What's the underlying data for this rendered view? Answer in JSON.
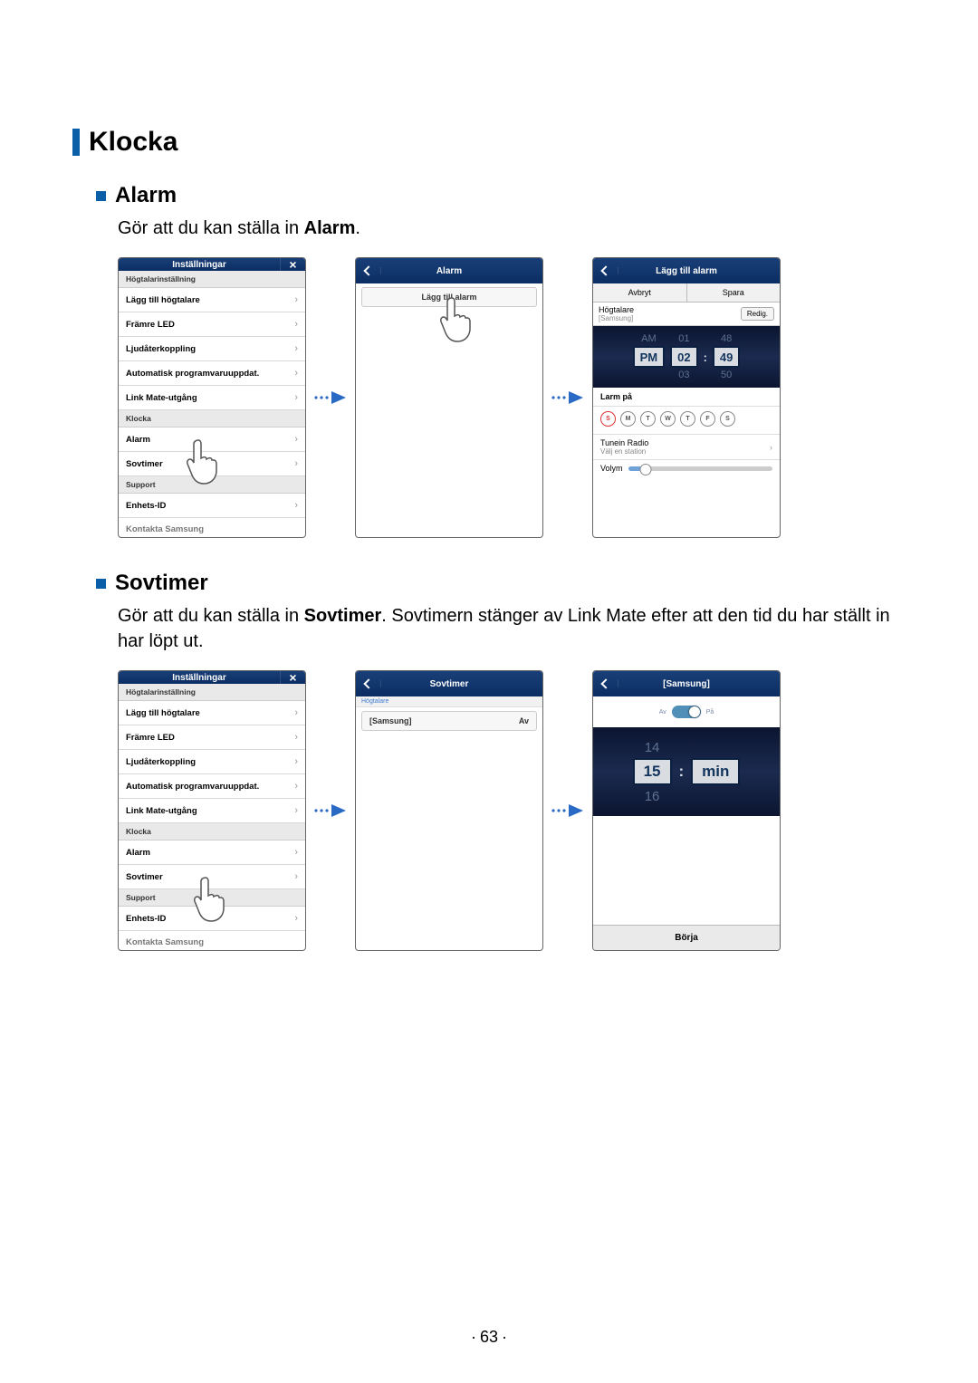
{
  "section": {
    "klocka": "Klocka",
    "alarm": "Alarm",
    "sovtimer": "Sovtimer"
  },
  "txt": {
    "alarm_pre": "Gör att du kan ställa in ",
    "alarm_bold": "Alarm",
    "alarm_post": ".",
    "sov_pre": "Gör att du kan ställa in ",
    "sov_bold": "Sovtimer",
    "sov_post": ". Sovtimern stänger av Link Mate efter att den tid du har ställt in har löpt ut."
  },
  "settings": {
    "title": "Inställningar",
    "sec_speaker": "Högtalarinställning",
    "items_speaker": [
      "Lägg till högtalare",
      "Främre LED",
      "Ljudåterkoppling",
      "Automatisk programvaruuppdat.",
      "Link Mate-utgång"
    ],
    "sec_klocka": "Klocka",
    "items_klocka": [
      "Alarm",
      "Sovtimer"
    ],
    "sec_support": "Support",
    "items_support": [
      "Enhets-ID"
    ],
    "cutoff": "Kontakta Samsung"
  },
  "alarm_screen": {
    "title": "Alarm",
    "add": "Lägg till alarm"
  },
  "add_alarm": {
    "title": "Lägg till alarm",
    "cancel": "Avbryt",
    "save": "Spara",
    "speaker_label": "Högtalare",
    "speaker_value": "[Samsung]",
    "edit": "Redig.",
    "ampm_top": "AM",
    "ampm_sel": "PM",
    "h_top": "01",
    "h_sel": "02",
    "h_bot": "03",
    "m_top": "48",
    "m_sel": "49",
    "m_bot": "50",
    "larm_pa": "Larm på",
    "days": [
      "S",
      "M",
      "T",
      "W",
      "T",
      "F",
      "S"
    ],
    "tunein": "Tunein Radio",
    "tunein_sub": "Välj en station",
    "volume": "Volym"
  },
  "sovtimer_screen": {
    "title": "Sovtimer",
    "group": "Högtalare",
    "item": "[Samsung]",
    "state": "Av"
  },
  "samsung_screen": {
    "title": "[Samsung]",
    "off": "Av",
    "on": "På",
    "v_top": "14",
    "v_sel": "15",
    "v_bot": "16",
    "unit": "min",
    "start": "Börja"
  },
  "page_number": "63"
}
